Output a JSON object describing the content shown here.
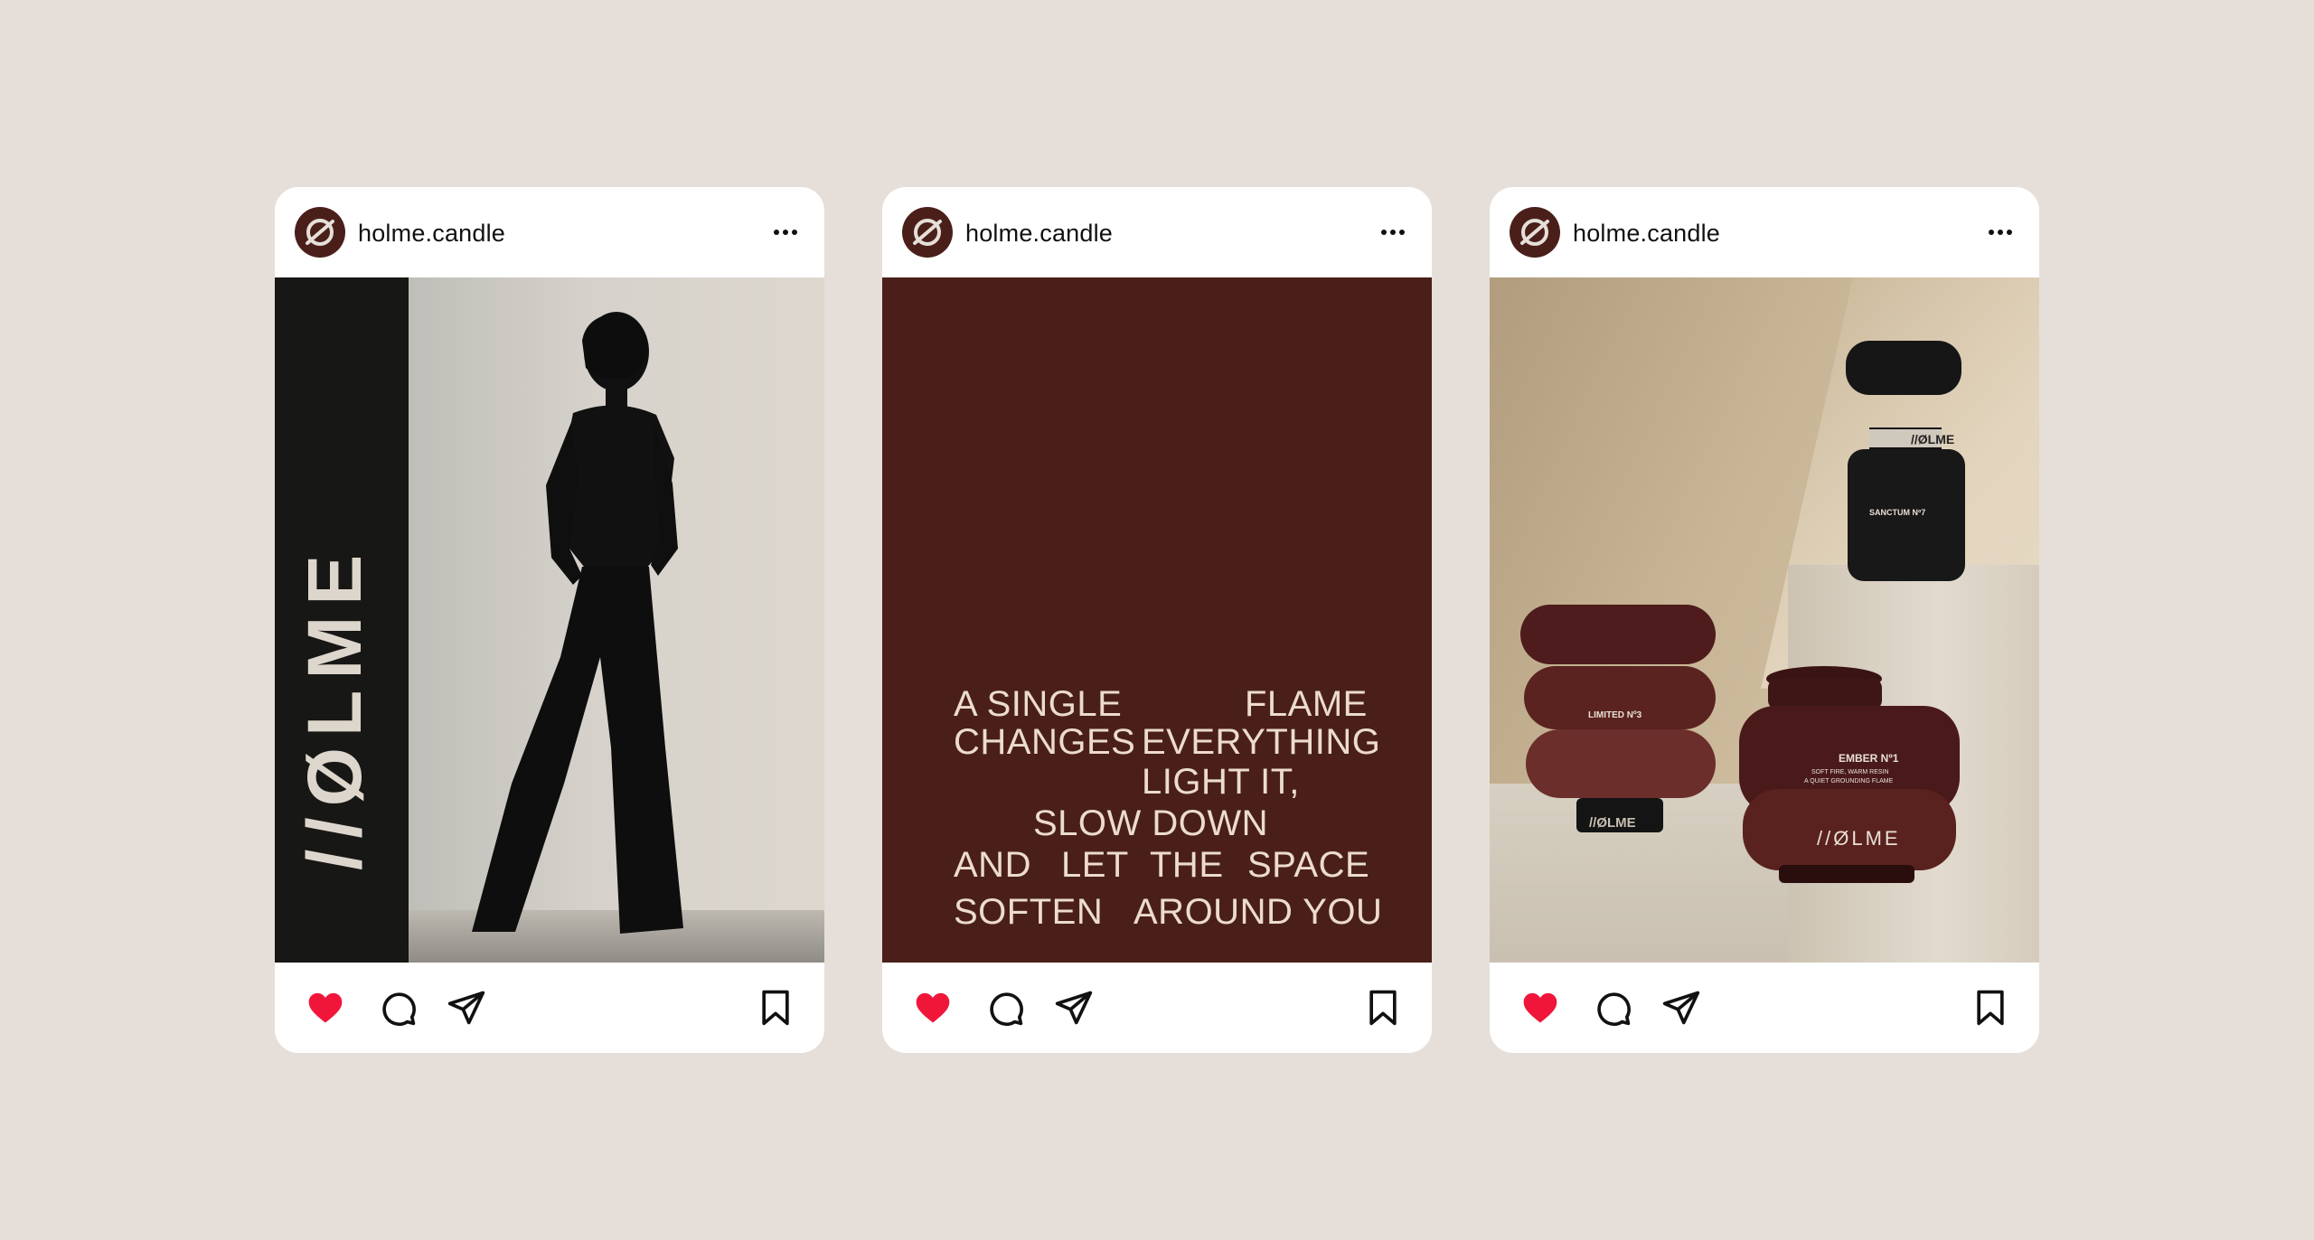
{
  "background_color": "#e6dfd9",
  "brand_color": "#4a1f1a",
  "like_color": "#f0163a",
  "posts": [
    {
      "username": "holme.candle",
      "avatar_icon": "holme-logo-icon",
      "image_alt": "silhouette-woman-photo",
      "brand_logo": "//ØLME"
    },
    {
      "username": "holme.candle",
      "avatar_icon": "holme-logo-icon",
      "quote_lines": [
        [
          "A SINGLE",
          "FLAME"
        ],
        [
          "CHANGES",
          "EVERYTHING"
        ],
        [
          "LIGHT IT,"
        ],
        [
          "SLOW DOWN"
        ],
        [
          "AND",
          "LET",
          "THE",
          "SPACE"
        ],
        [
          "SOFTEN",
          "AROUND YOU"
        ]
      ]
    },
    {
      "username": "holme.candle",
      "avatar_icon": "holme-logo-icon",
      "products": {
        "bottle_logo": "//ØLME",
        "bottle_name": "SANCTUM Nº7",
        "stack_name": "LIMITED Nº3",
        "stack_logo": "//ØLME",
        "jar_name": "EMBER Nº1",
        "jar_desc_1": "SOFT FIRE, WARM RESIN",
        "jar_desc_2": "A QUIET GROUNDING FLAME",
        "jar_logo": "//ØLME"
      }
    }
  ],
  "actions": {
    "like_icon": "heart-icon",
    "comment_icon": "comment-icon",
    "share_icon": "paper-plane-icon",
    "save_icon": "bookmark-icon",
    "more_icon": "more-icon"
  }
}
